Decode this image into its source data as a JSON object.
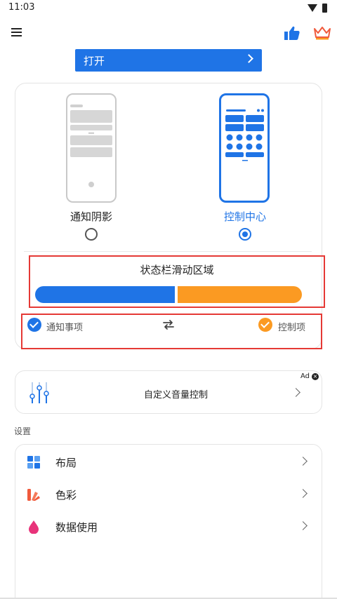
{
  "status_bar": {
    "time": "11:03"
  },
  "open_button": {
    "label": "打开"
  },
  "modes": {
    "left_label": "通知阴影",
    "right_label": "控制中心",
    "selected": "right"
  },
  "slide_zone": {
    "title": "状态栏滑动区域"
  },
  "items": {
    "left_label": "通知事项",
    "right_label": "控制项"
  },
  "volume_card": {
    "label": "自定义音量控制",
    "ad_badge": "Ad"
  },
  "settings": {
    "section_title": "设置",
    "rows": [
      {
        "label": "布局",
        "icon": "grid-icon"
      },
      {
        "label": "色彩",
        "icon": "palette-icon"
      },
      {
        "label": "数据使用",
        "icon": "drop-icon"
      }
    ]
  },
  "colors": {
    "accent_blue": "#1f74e6",
    "accent_orange": "#fb9a22",
    "highlight_red": "#e53935",
    "palette_red": "#f05a3c",
    "drop_pink": "#e8337a"
  }
}
